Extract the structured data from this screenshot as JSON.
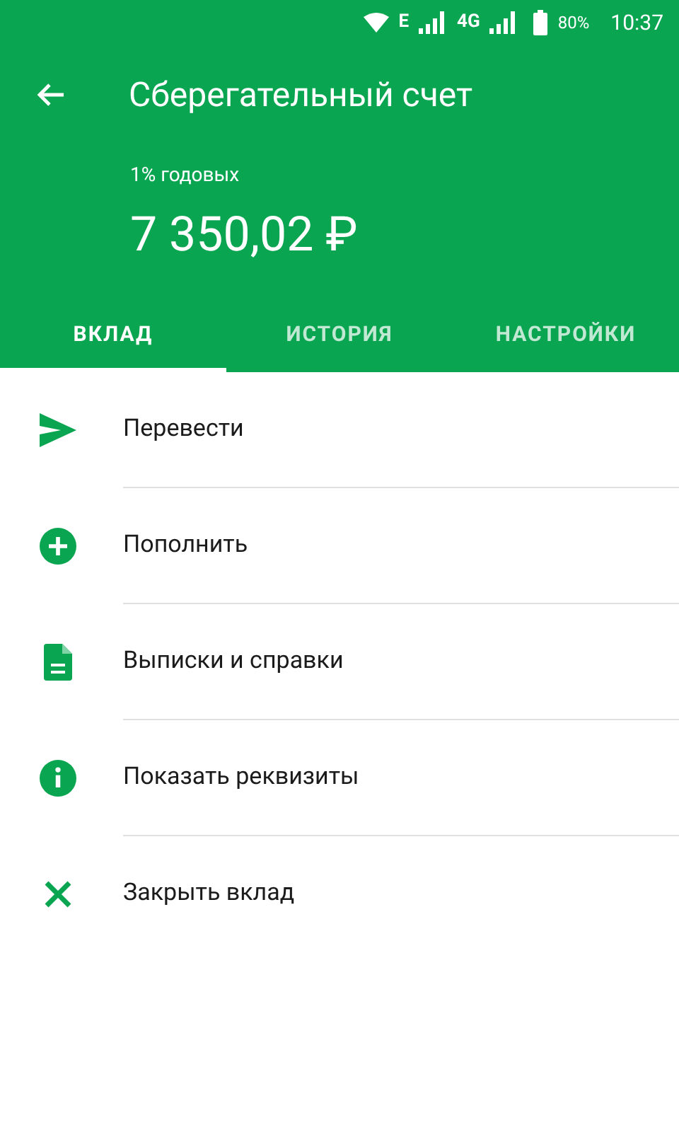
{
  "status_bar": {
    "network_1": "E",
    "network_2": "4G",
    "battery": "80%",
    "time": "10:37"
  },
  "header": {
    "title": "Сберегательный счет",
    "rate": "1% годовых",
    "balance": "7 350,02 ₽"
  },
  "tabs": [
    {
      "label": "ВКЛАД",
      "selected": true
    },
    {
      "label": "ИСТОРИЯ",
      "selected": false
    },
    {
      "label": "НАСТРОЙКИ",
      "selected": false
    }
  ],
  "actions": [
    {
      "kind": "send",
      "label": "Перевести"
    },
    {
      "kind": "add",
      "label": "Пополнить"
    },
    {
      "kind": "document",
      "label": "Выписки и справки"
    },
    {
      "kind": "info",
      "label": "Показать реквизиты"
    },
    {
      "kind": "close",
      "label": "Закрыть вклад"
    }
  ]
}
